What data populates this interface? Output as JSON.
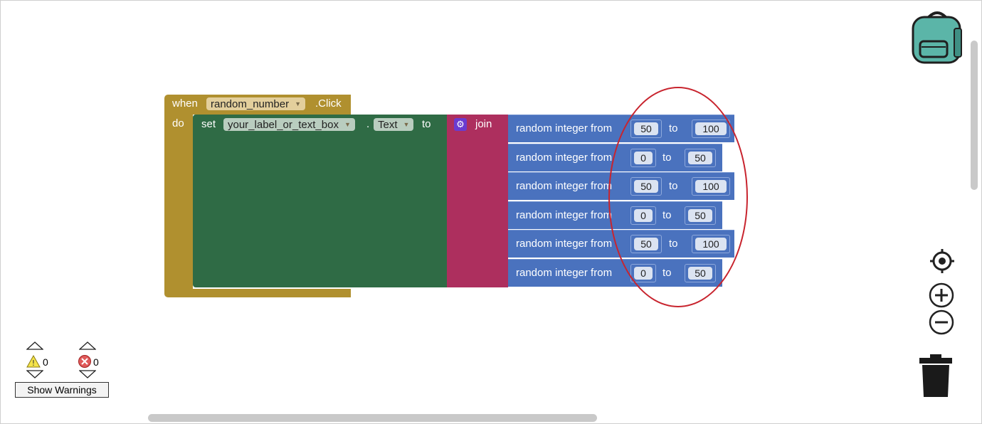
{
  "event_block": {
    "when_label": "when",
    "component": "random_number",
    "event": ".Click",
    "do_label": "do"
  },
  "set_block": {
    "set_label": "set",
    "component": "your_label_or_text_box",
    "dot": ".",
    "property": "Text",
    "to_label": "to"
  },
  "join_block": {
    "label": "join"
  },
  "random_blocks": [
    {
      "label": "random integer from",
      "from": "50",
      "to_label": "to",
      "to": "100"
    },
    {
      "label": "random integer from",
      "from": "0",
      "to_label": "to",
      "to": "50"
    },
    {
      "label": "random integer from",
      "from": "50",
      "to_label": "to",
      "to": "100"
    },
    {
      "label": "random integer from",
      "from": "0",
      "to_label": "to",
      "to": "50"
    },
    {
      "label": "random integer from",
      "from": "50",
      "to_label": "to",
      "to": "100"
    },
    {
      "label": "random integer from",
      "from": "0",
      "to_label": "to",
      "to": "50"
    }
  ],
  "warnings": {
    "warning_count": "0",
    "error_count": "0",
    "show_warnings_label": "Show Warnings"
  },
  "colors": {
    "event": "#b0902f",
    "set": "#2f6b45",
    "join": "#ad2f5e",
    "math": "#4a72be",
    "annotation": "#c8242e"
  }
}
